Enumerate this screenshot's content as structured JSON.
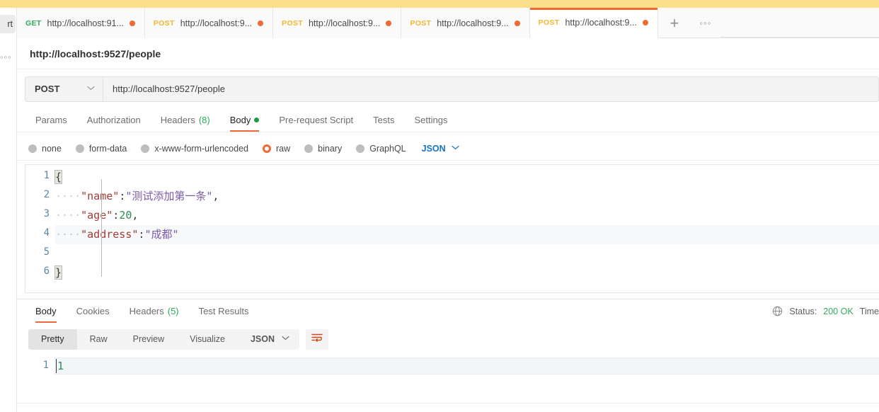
{
  "banner": {
    "text": ""
  },
  "rail": {
    "import_label": "rt",
    "more_label": "◦◦◦"
  },
  "tabbar": {
    "tabs": [
      {
        "method": "GET",
        "url": "http://localhost:91...",
        "unsaved": true,
        "active": false
      },
      {
        "method": "POST",
        "url": "http://localhost:9...",
        "unsaved": true,
        "active": false
      },
      {
        "method": "POST",
        "url": "http://localhost:9...",
        "unsaved": true,
        "active": false
      },
      {
        "method": "POST",
        "url": "http://localhost:9...",
        "unsaved": true,
        "active": false
      },
      {
        "method": "POST",
        "url": "http://localhost:9...",
        "unsaved": true,
        "active": true
      }
    ],
    "new_tab_label": "+",
    "more_label": "◦◦◦"
  },
  "request": {
    "title": "http://localhost:9527/people",
    "method": "POST",
    "url": "http://localhost:9527/people",
    "tabs": [
      {
        "label": "Params",
        "count": "",
        "dot": false,
        "active": false
      },
      {
        "label": "Authorization",
        "count": "",
        "dot": false,
        "active": false
      },
      {
        "label": "Headers",
        "count": "(8)",
        "dot": false,
        "active": false
      },
      {
        "label": "Body",
        "count": "",
        "dot": true,
        "active": true
      },
      {
        "label": "Pre-request Script",
        "count": "",
        "dot": false,
        "active": false
      },
      {
        "label": "Tests",
        "count": "",
        "dot": false,
        "active": false
      },
      {
        "label": "Settings",
        "count": "",
        "dot": false,
        "active": false
      }
    ],
    "body_types": [
      {
        "label": "none",
        "selected": false
      },
      {
        "label": "form-data",
        "selected": false
      },
      {
        "label": "x-www-form-urlencoded",
        "selected": false
      },
      {
        "label": "raw",
        "selected": true
      },
      {
        "label": "binary",
        "selected": false
      },
      {
        "label": "GraphQL",
        "selected": false
      }
    ],
    "raw_format": "JSON",
    "editor": {
      "line_numbers": [
        "1",
        "2",
        "3",
        "4",
        "5",
        "6"
      ],
      "lines": [
        {
          "n": "1",
          "indent": "",
          "key": "",
          "sep": "",
          "value": "",
          "vtype": "",
          "comma": "",
          "brace": "{",
          "highlight": false
        },
        {
          "n": "2",
          "indent": "····",
          "key": "\"name\"",
          "sep": ":",
          "value": "\"测试添加第一条\"",
          "vtype": "str",
          "comma": ",",
          "brace": "",
          "highlight": false
        },
        {
          "n": "3",
          "indent": "····",
          "key": "\"age\"",
          "sep": ":",
          "value": "20",
          "vtype": "num",
          "comma": ",",
          "brace": "",
          "highlight": false
        },
        {
          "n": "4",
          "indent": "····",
          "key": "\"address\"",
          "sep": ":",
          "value": "\"成都\"",
          "vtype": "str",
          "comma": "",
          "brace": "",
          "highlight": true
        },
        {
          "n": "5",
          "indent": "",
          "key": "",
          "sep": "",
          "value": "",
          "vtype": "",
          "comma": "",
          "brace": "",
          "highlight": false
        },
        {
          "n": "6",
          "indent": "",
          "key": "",
          "sep": "",
          "value": "",
          "vtype": "",
          "comma": "",
          "brace": "}",
          "highlight": false
        }
      ]
    }
  },
  "response": {
    "tabs": [
      {
        "label": "Body",
        "count": "",
        "active": true
      },
      {
        "label": "Cookies",
        "count": "",
        "active": false
      },
      {
        "label": "Headers",
        "count": "(5)",
        "active": false
      },
      {
        "label": "Test Results",
        "count": "",
        "active": false
      }
    ],
    "status_label": "Status:",
    "status_code": "200 OK",
    "time_label": "Time",
    "view_modes": [
      {
        "label": "Pretty",
        "active": true
      },
      {
        "label": "Raw",
        "active": false
      },
      {
        "label": "Preview",
        "active": false
      },
      {
        "label": "Visualize",
        "active": false
      }
    ],
    "format": "JSON",
    "body": {
      "line_numbers": [
        "1"
      ],
      "value": "1"
    }
  },
  "colors": {
    "accent": "#f06a35",
    "get_method": "#2eab5b",
    "post_method": "#f5b631",
    "success": "#2eab5b",
    "link": "#1774c4",
    "banner": "#fbdf8b"
  }
}
